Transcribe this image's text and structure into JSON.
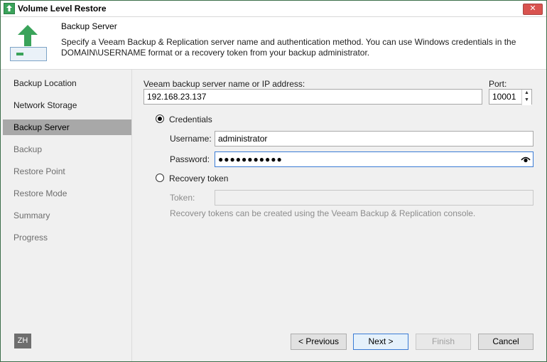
{
  "window": {
    "title": "Volume Level Restore",
    "close_glyph": "✕"
  },
  "header": {
    "title": "Backup Server",
    "description": "Specify a Veeam Backup & Replication server name and authentication method. You can use Windows credentials in the DOMAIN\\USERNAME format or a recovery token from your backup administrator."
  },
  "sidebar": {
    "items": [
      {
        "label": "Backup Location",
        "state": "normal"
      },
      {
        "label": "Network Storage",
        "state": "normal"
      },
      {
        "label": "Backup Server",
        "state": "active"
      },
      {
        "label": "Backup",
        "state": "disabled"
      },
      {
        "label": "Restore Point",
        "state": "disabled"
      },
      {
        "label": "Restore Mode",
        "state": "disabled"
      },
      {
        "label": "Summary",
        "state": "disabled"
      },
      {
        "label": "Progress",
        "state": "disabled"
      }
    ],
    "language_badge": "ZH"
  },
  "form": {
    "server_label": "Veeam backup server name or IP address:",
    "server_value": "192.168.23.137",
    "port_label": "Port:",
    "port_value": "10001",
    "credentials_label": "Credentials",
    "credentials_selected": true,
    "username_label": "Username:",
    "username_value": "administrator",
    "password_label": "Password:",
    "password_value": "●●●●●●●●●●●",
    "token_option_label": "Recovery token",
    "token_label": "Token:",
    "token_value": "",
    "token_hint": "Recovery tokens can be created using the Veeam Backup & Replication console."
  },
  "buttons": {
    "previous": "< Previous",
    "next": "Next >",
    "finish": "Finish",
    "cancel": "Cancel"
  },
  "colors": {
    "accent": "#3a7bd5",
    "brand_green": "#3aa35a",
    "active_nav": "#a8a8a8"
  }
}
